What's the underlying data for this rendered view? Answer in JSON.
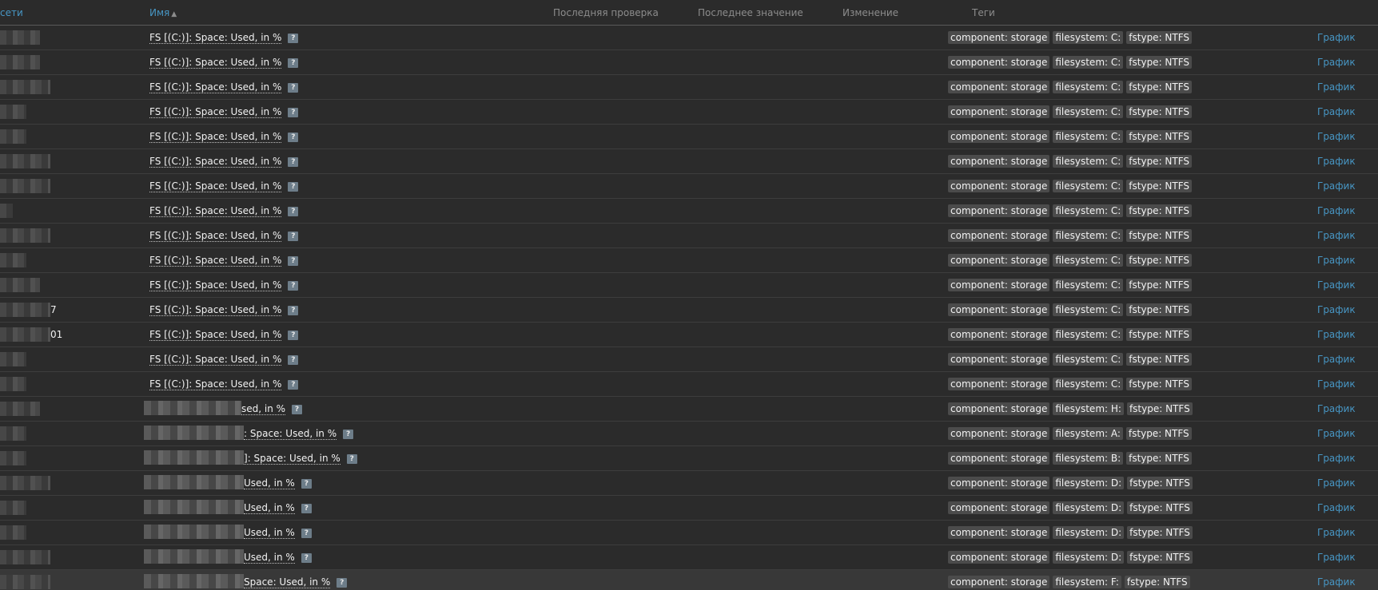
{
  "header": {
    "col_host": "сети",
    "col_name": "Имя",
    "sort_arrow": "▲",
    "col_last_check": "Последняя проверка",
    "col_last_value": "Последнее значение",
    "col_change": "Изменение",
    "col_tags": "Теги"
  },
  "colors": {
    "background": "#2b2b2b",
    "link": "#4796c4",
    "tag_bg": "#4b4b4b",
    "help_icon_bg": "#6d7d89"
  },
  "icons": {
    "help": "question-mark-icon"
  },
  "rows": [
    {
      "host_tail": "",
      "name": "FS [(C:)]: Space: Used, in %",
      "tags": [
        "component: storage",
        "filesystem: C:",
        "fstype: NTFS"
      ],
      "graph": "График"
    },
    {
      "host_tail": "",
      "name": "FS [(C:)]: Space: Used, in %",
      "tags": [
        "component: storage",
        "filesystem: C:",
        "fstype: NTFS"
      ],
      "graph": "График"
    },
    {
      "host_tail": "",
      "name": "FS [(C:)]: Space: Used, in %",
      "tags": [
        "component: storage",
        "filesystem: C:",
        "fstype: NTFS"
      ],
      "graph": "График"
    },
    {
      "host_tail": "",
      "name": "FS [(C:)]: Space: Used, in %",
      "tags": [
        "component: storage",
        "filesystem: C:",
        "fstype: NTFS"
      ],
      "graph": "График"
    },
    {
      "host_tail": "",
      "name": "FS [(C:)]: Space: Used, in %",
      "tags": [
        "component: storage",
        "filesystem: C:",
        "fstype: NTFS"
      ],
      "graph": "График"
    },
    {
      "host_tail": "",
      "name": "FS [(C:)]: Space: Used, in %",
      "tags": [
        "component: storage",
        "filesystem: C:",
        "fstype: NTFS"
      ],
      "graph": "График"
    },
    {
      "host_tail": "",
      "name": "FS [(C:)]: Space: Used, in %",
      "tags": [
        "component: storage",
        "filesystem: C:",
        "fstype: NTFS"
      ],
      "graph": "График"
    },
    {
      "host_tail": "",
      "name": "FS [(C:)]: Space: Used, in %",
      "tags": [
        "component: storage",
        "filesystem: C:",
        "fstype: NTFS"
      ],
      "graph": "График"
    },
    {
      "host_tail": "",
      "name": "FS [(C:)]: Space: Used, in %",
      "tags": [
        "component: storage",
        "filesystem: C:",
        "fstype: NTFS"
      ],
      "graph": "График"
    },
    {
      "host_tail": "",
      "name": "FS [(C:)]: Space: Used, in %",
      "tags": [
        "component: storage",
        "filesystem: C:",
        "fstype: NTFS"
      ],
      "graph": "График"
    },
    {
      "host_tail": "",
      "name": "FS [(C:)]: Space: Used, in %",
      "tags": [
        "component: storage",
        "filesystem: C:",
        "fstype: NTFS"
      ],
      "graph": "График"
    },
    {
      "host_tail": "7",
      "name": "FS [(C:)]: Space: Used, in %",
      "tags": [
        "component: storage",
        "filesystem: C:",
        "fstype: NTFS"
      ],
      "graph": "График"
    },
    {
      "host_tail": "01",
      "name": "FS [(C:)]: Space: Used, in %",
      "tags": [
        "component: storage",
        "filesystem: C:",
        "fstype: NTFS"
      ],
      "graph": "График"
    },
    {
      "host_tail": "",
      "name": "FS [(C:)]: Space: Used, in %",
      "tags": [
        "component: storage",
        "filesystem: C:",
        "fstype: NTFS"
      ],
      "graph": "График"
    },
    {
      "host_tail": "",
      "name": "FS [(C:)]: Space: Used, in %",
      "tags": [
        "component: storage",
        "filesystem: C:",
        "fstype: NTFS"
      ],
      "graph": "График"
    },
    {
      "host_tail": "",
      "name": "sed, in %",
      "tags": [
        "component: storage",
        "filesystem: H:",
        "fstype: NTFS"
      ],
      "graph": "График"
    },
    {
      "host_tail": "",
      "name": ": Space: Used, in %",
      "tags": [
        "component: storage",
        "filesystem: A:",
        "fstype: NTFS"
      ],
      "graph": "График"
    },
    {
      "host_tail": "",
      "name": "]: Space: Used, in %",
      "tags": [
        "component: storage",
        "filesystem: B:",
        "fstype: NTFS"
      ],
      "graph": "График"
    },
    {
      "host_tail": "",
      "name": "Used, in %",
      "tags": [
        "component: storage",
        "filesystem: D:",
        "fstype: NTFS"
      ],
      "graph": "График"
    },
    {
      "host_tail": "",
      "name": "Used, in %",
      "tags": [
        "component: storage",
        "filesystem: D:",
        "fstype: NTFS"
      ],
      "graph": "График"
    },
    {
      "host_tail": "",
      "name": "Used, in %",
      "tags": [
        "component: storage",
        "filesystem: D:",
        "fstype: NTFS"
      ],
      "graph": "График"
    },
    {
      "host_tail": "",
      "name": "Used, in %",
      "tags": [
        "component: storage",
        "filesystem: D:",
        "fstype: NTFS"
      ],
      "graph": "График"
    },
    {
      "host_tail": "",
      "name": "Space: Used, in %",
      "tags": [
        "component: storage",
        "filesystem: F:",
        "fstype: NTFS"
      ],
      "graph": "График"
    }
  ]
}
